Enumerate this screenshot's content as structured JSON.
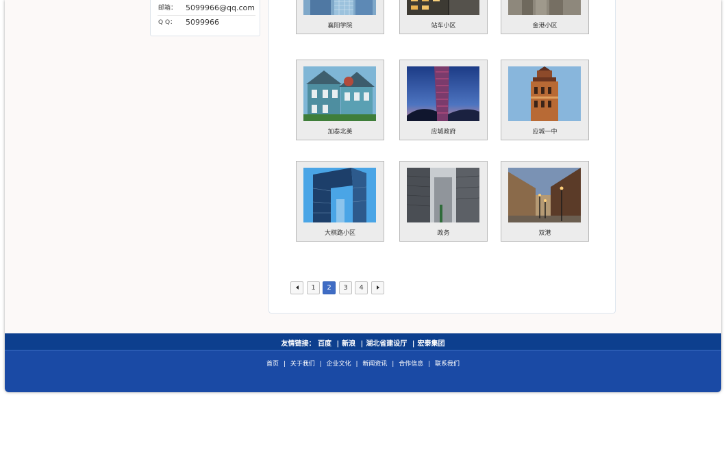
{
  "contact": {
    "email_label": "邮箱：",
    "email_value": "5099966@qq.com",
    "qq_label": "Q Q：",
    "qq_value": "5099966"
  },
  "gallery": {
    "items": [
      {
        "caption": "襄阳学院",
        "icon": "building-photo"
      },
      {
        "caption": "站车小区",
        "icon": "building-photo"
      },
      {
        "caption": "金港小区",
        "icon": "building-photo"
      },
      {
        "caption": "加泰北美",
        "icon": "house-photo"
      },
      {
        "caption": "应城政府",
        "icon": "tower-photo"
      },
      {
        "caption": "应城一中",
        "icon": "tower-photo"
      },
      {
        "caption": "大棋路小区",
        "icon": "building-photo"
      },
      {
        "caption": "政务",
        "icon": "building-photo"
      },
      {
        "caption": "双港",
        "icon": "street-photo"
      }
    ]
  },
  "pagination": {
    "prev": "previous-page",
    "pages": [
      "1",
      "2",
      "3",
      "4"
    ],
    "current": "2",
    "next": "next-page"
  },
  "footer": {
    "links_label": "友情链接：",
    "links": [
      "百度",
      "新浪",
      "湖北省建设厅",
      "宏泰集团"
    ],
    "separator": "|",
    "nav": [
      "首页",
      "关于我们",
      "企业文化",
      "新闻资讯",
      "合作信息",
      "联系我们"
    ]
  },
  "colors": {
    "footer_dark": "#0d3f8e",
    "footer_main": "#1a4aa5",
    "page_active": "#3f6cc4"
  }
}
